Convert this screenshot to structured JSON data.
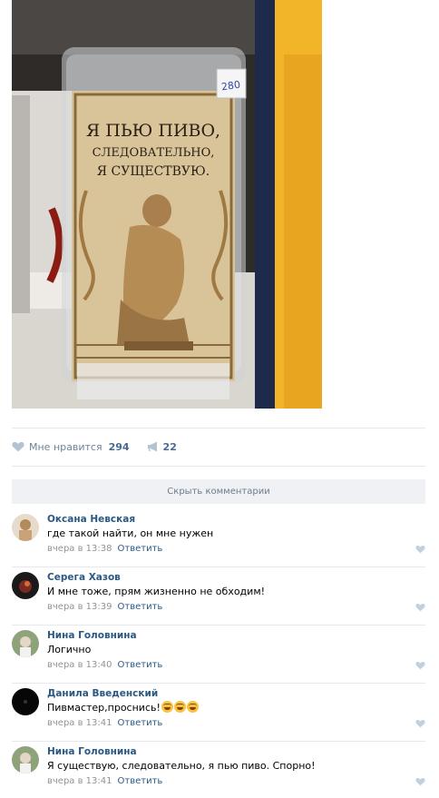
{
  "photo": {
    "price_tag": "280",
    "mug_text_line1": "Я ПЬЮ ПИВО,",
    "mug_text_line2": "СЛЕДОВАТЕЛЬНО,",
    "mug_text_line3": "Я СУЩЕСТВУЮ."
  },
  "actions": {
    "like_label": "Мне нравится",
    "like_count": "294",
    "share_count": "22"
  },
  "comments_toggle": "Скрыть комментарии",
  "comments": [
    {
      "author": "Оксана Невская",
      "text": "где такой найти, он мне нужен",
      "time": "вчера в 13:38",
      "reply": "Ответить"
    },
    {
      "author": "Серега Хазов",
      "text": "И мне тоже, прям жизненно не обходим!",
      "time": "вчера в 13:39",
      "reply": "Ответить"
    },
    {
      "author": "Нина Головнина",
      "text": "Логично",
      "time": "вчера в 13:40",
      "reply": "Ответить"
    },
    {
      "author": "Данила Введенский",
      "text": "Пивмастер,проснись!",
      "emoji_count": 3,
      "time": "вчера в 13:41",
      "reply": "Ответить"
    },
    {
      "author": "Нина Головнина",
      "text": "Я существую, следовательно, я пью пиво. Спорно!",
      "time": "вчера в 13:41",
      "reply": "Ответить"
    }
  ],
  "colors": {
    "link": "#2a5885",
    "meta": "#939393",
    "action": "#6f829b",
    "bar_bg": "#eff1f4"
  }
}
